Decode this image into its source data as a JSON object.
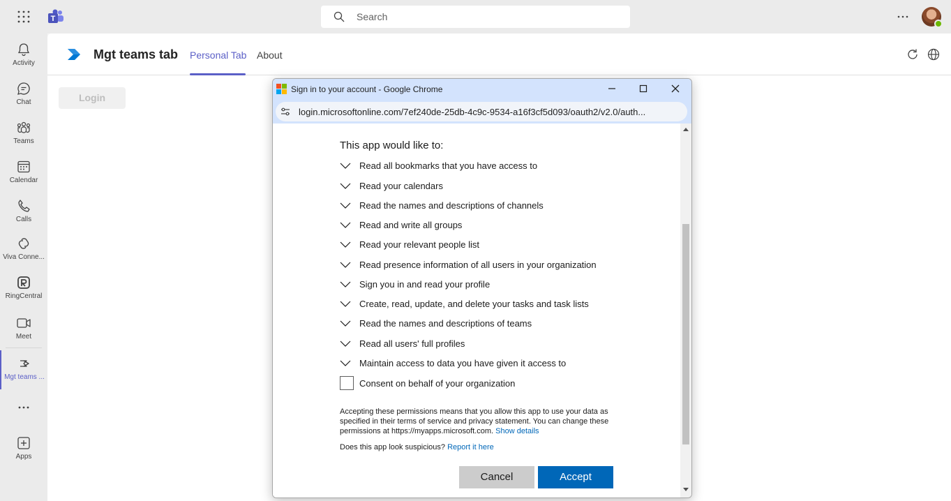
{
  "topbar": {
    "search_placeholder": "Search",
    "icons": [
      "apps-grid-icon",
      "teams-logo-icon",
      "search-icon",
      "more-options-icon",
      "avatar"
    ]
  },
  "rail": {
    "items": [
      {
        "label": "Activity",
        "icon": "bell-icon"
      },
      {
        "label": "Chat",
        "icon": "chat-icon"
      },
      {
        "label": "Teams",
        "icon": "teams-icon"
      },
      {
        "label": "Calendar",
        "icon": "calendar-icon"
      },
      {
        "label": "Calls",
        "icon": "phone-icon"
      },
      {
        "label": "Viva Conne...",
        "icon": "viva-connections-icon"
      },
      {
        "label": "RingCentral",
        "icon": "ringcentral-icon"
      },
      {
        "label": "Meet",
        "icon": "video-icon"
      },
      {
        "label": "Mgt teams ...",
        "icon": "mgt-app-icon"
      },
      {
        "label": "Apps",
        "icon": "add-app-icon"
      }
    ],
    "more_icon": "more-dots-icon"
  },
  "app": {
    "title": "Mgt teams tab",
    "tabs": [
      {
        "label": "Personal Tab",
        "active": true
      },
      {
        "label": "About",
        "active": false
      }
    ],
    "login_label": "Login"
  },
  "popup": {
    "window_title": "Sign in to your account - Google Chrome",
    "url": "login.microsoftonline.com/7ef240de-25db-4c9c-9534-a16f3cf5d093/oauth2/v2.0/auth...",
    "intro": "This app would like to:",
    "permissions": [
      "Read all bookmarks that you have access to",
      "Read your calendars",
      "Read the names and descriptions of channels",
      "Read and write all groups",
      "Read your relevant people list",
      "Read presence information of all users in your organization",
      "Sign you in and read your profile",
      "Create, read, update, and delete your tasks and task lists",
      "Read the names and descriptions of teams",
      "Read all users' full profiles",
      "Maintain access to data you have given it access to"
    ],
    "consent_label": "Consent on behalf of your organization",
    "disclaimer": "Accepting these permissions means that you allow this app to use your data as specified in their terms of service and privacy statement. You can change these permissions at https://myapps.microsoft.com.",
    "show_details": "Show details",
    "suspicious_text": "Does this app look suspicious?",
    "report_link": "Report it here",
    "cancel_label": "Cancel",
    "accept_label": "Accept",
    "accent_color": "#0067b8"
  }
}
